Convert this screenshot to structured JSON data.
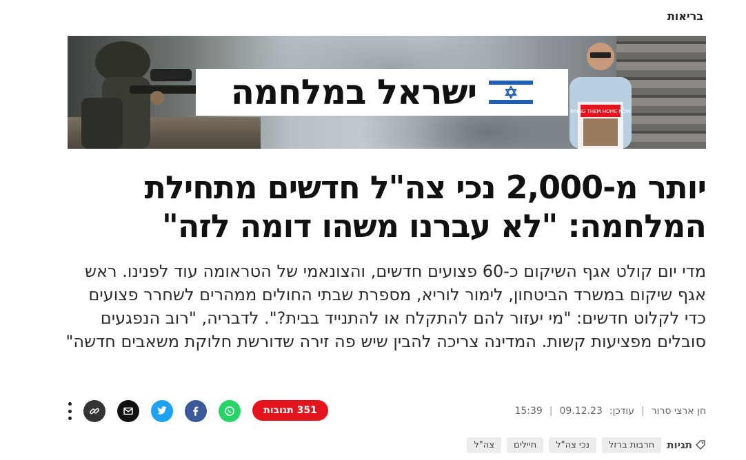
{
  "category": "בריאות",
  "banner": {
    "title": "ישראל במלחמה",
    "poster_text": "BRING THEM HOME NOW"
  },
  "headline": "יותר מ-2,000 נכי צה\"ל חדשים מתחילת המלחמה: \"לא עברנו משהו דומה לזה\"",
  "lead": "מדי יום קולט אגף השיקום כ-60 פצועים חדשים, והצונאמי של הטראומה עוד לפנינו. ראש אגף שיקום במשרד הביטחון, לימור לוריא, מספרת שבתי החולים ממהרים לשחרר פצועים כדי לקלוט חדשים: \"מי יעזור להם להתקלח או להתנייד בבית?\". לדבריה, \"רוב הנפגעים סובלים מפציעות קשות. המדינה צריכה להבין שיש פה זירה שדורשת חלוקת משאבים חדשה\"",
  "meta": {
    "author": "חן ארצי סרור",
    "updated_label": "עודכן:",
    "date": "09.12.23",
    "time": "15:39"
  },
  "comments": {
    "label": "351 תגובות"
  },
  "share": {
    "whatsapp": "whatsapp-icon",
    "facebook": "facebook-icon",
    "twitter": "twitter-icon",
    "email": "email-icon",
    "link": "link-icon"
  },
  "colors": {
    "comments_red": "#e4131c",
    "whatsapp": "#25d366",
    "facebook": "#3b5998",
    "twitter": "#1da1f2",
    "email": "#111111",
    "link": "#333333"
  },
  "tags": {
    "title": "תגיות",
    "items": [
      "חרבות ברזל",
      "נכי צה\"ל",
      "חיילים",
      "צה\"ל"
    ]
  }
}
